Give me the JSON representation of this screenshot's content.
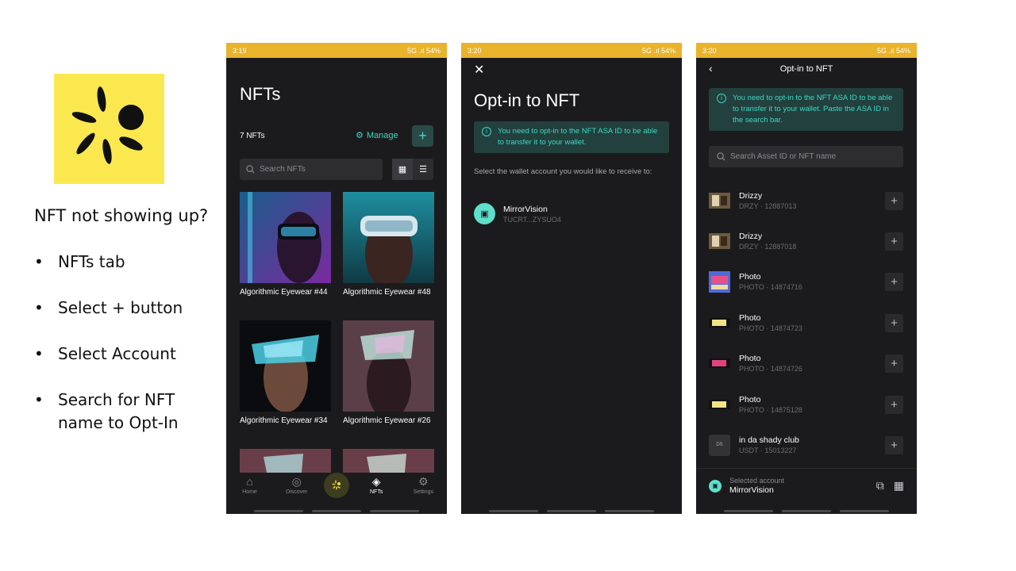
{
  "slide": {
    "title": "NFT not showing up?",
    "bullets": [
      "NFTs tab",
      "Select + button",
      "Select Account",
      "Search for NFT name to Opt-In"
    ],
    "bullet_char": "•"
  },
  "phone1": {
    "status_time": "3:19",
    "status_right": "5G .ıl 54%",
    "title": "NFTs",
    "count": "7 NFTs",
    "manage_label": "Manage",
    "add_symbol": "+",
    "search_placeholder": "Search NFTs",
    "nfts": [
      {
        "name": "Algorithmic Eyewear #44"
      },
      {
        "name": "Algorithmic Eyewear #48"
      },
      {
        "name": "Algorithmic Eyewear #34"
      },
      {
        "name": "Algorithmic Eyewear #26"
      }
    ],
    "tabs": [
      "Home",
      "Discover",
      "NFTs",
      "Settings"
    ]
  },
  "phone2": {
    "status_time": "3:20",
    "status_right": "5G .ıl 54%",
    "close_symbol": "✕",
    "title": "Opt-in to NFT",
    "info": "You need to opt-in to the NFT ASA ID to be able to transfer it to your wallet.",
    "select_text": "Select the wallet account you would like to receive to:",
    "account_name": "MirrorVision",
    "account_address": "TUCRT...ZYSUO4"
  },
  "phone3": {
    "status_time": "3:20",
    "status_right": "5G .ıl 54%",
    "back_symbol": "‹",
    "title": "Opt-in to NFT",
    "info": "You need to opt-in to the NFT ASA ID to be able to transfer it to your wallet. Paste the ASA ID in the search bar.",
    "search_placeholder": "Search Asset ID or NFT name",
    "assets": [
      {
        "name": "Drizzy",
        "sub": "DRZY · 12887013"
      },
      {
        "name": "Drizzy",
        "sub": "DRZY · 12887018"
      },
      {
        "name": "Photo",
        "sub": "PHOTO · 14874716"
      },
      {
        "name": "Photo",
        "sub": "PHOTO · 14874723"
      },
      {
        "name": "Photo",
        "sub": "PHOTO · 14874726"
      },
      {
        "name": "Photo",
        "sub": "PHOTO · 14875128"
      },
      {
        "name": "in da shady club",
        "sub": "USDT · 15013227"
      }
    ],
    "selected_label": "Selected account",
    "selected_value": "MirrorVision"
  },
  "colors": {
    "status_bar": "#e9b32b",
    "accent": "#3ed7c3",
    "logo_bg": "#fbe84f"
  }
}
